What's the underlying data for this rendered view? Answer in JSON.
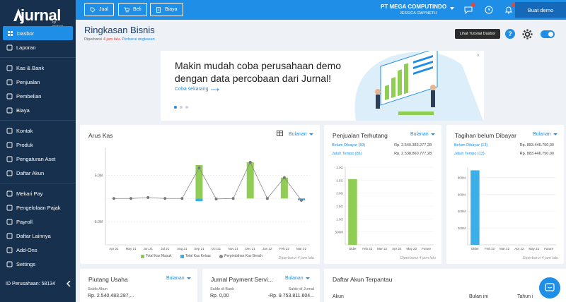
{
  "sidebar": {
    "logo": "jurnal",
    "logo_sub": "by mekari",
    "items": [
      {
        "label": "Dasbor",
        "icon": "dashboard-icon"
      },
      {
        "label": "Laporan",
        "icon": "report-icon"
      },
      {
        "label": "Kas & Bank",
        "icon": "bank-icon"
      },
      {
        "label": "Penjualan",
        "icon": "tag-icon"
      },
      {
        "label": "Pembelian",
        "icon": "cart-icon"
      },
      {
        "label": "Biaya",
        "icon": "receipt-icon"
      },
      {
        "label": "Kontak",
        "icon": "contact-icon"
      },
      {
        "label": "Produk",
        "icon": "box-icon"
      },
      {
        "label": "Pengaturan Aset",
        "icon": "asset-icon"
      },
      {
        "label": "Daftar Akun",
        "icon": "list-icon"
      },
      {
        "label": "Mekari Pay",
        "icon": "pay-icon"
      },
      {
        "label": "Pengelolaan Pajak",
        "icon": "tax-icon"
      },
      {
        "label": "Payroll",
        "icon": "payroll-icon"
      },
      {
        "label": "Daftar Lainnya",
        "icon": "clipboard-icon"
      },
      {
        "label": "Add-Ons",
        "icon": "addon-icon"
      },
      {
        "label": "Settings",
        "icon": "settings-icon"
      }
    ],
    "company_id": "ID Perusahaan: 58134"
  },
  "header": {
    "buttons": [
      "Jual",
      "Beli",
      "Biaya"
    ],
    "company": "PT MEGA COMPUTINDO",
    "user": "JESSICA GWYNETH",
    "demo": "Buat demo"
  },
  "page": {
    "title": "Ringkasan Bisnis",
    "updated_prefix": "Diperbarui",
    "updated_time": "4 jam lalu.",
    "refresh": "Perbarui ringkasan",
    "tooltip": "Lihat Tutorial Dasbor",
    "help": "?"
  },
  "banner": {
    "title": "Makin mudah coba perusahaan demo dengan data percobaan dari Jurnal!",
    "link": "Coba sekarang",
    "close": "×"
  },
  "arus_kas": {
    "title": "Arus Kas",
    "dropdown": "Bulanan",
    "footer": "Diperbarui 4 jam lalu",
    "legend": [
      "Total Kas Masuk",
      "Total Kas Keluar",
      "Perpindahan Kas Bersih"
    ]
  },
  "penjualan": {
    "title": "Penjualan Terhutang",
    "dropdown": "Bulanan",
    "rows": [
      {
        "label": "Belum Dibayar (83)",
        "value": "Rp. 2.540.383.277,28"
      },
      {
        "label": "Jatuh Tempo (81)",
        "value": "Rp. 2.538.860.777,28"
      }
    ],
    "footer": "Diperbarui 4 jam lalu"
  },
  "tagihan": {
    "title": "Tagihan belum Dibayar",
    "dropdown": "Bulanan",
    "rows": [
      {
        "label": "Belum Dibayar (13)",
        "value": "Rp. 883.446.750,00"
      },
      {
        "label": "Jatuh Tempo (13)",
        "value": "Rp. 883.446.750,00"
      }
    ],
    "footer": "Diperbarui 4 jam lalu"
  },
  "piutang": {
    "title": "Piutang Usaha",
    "dropdown": "Bulanan",
    "label": "Saldo Akun",
    "value": "Rp. 2.540.483.287,..."
  },
  "jurnal_pay": {
    "title": "Jurnal Payment Servi...",
    "dropdown": "Bulanan",
    "label1": "Saldo di Bank",
    "value1": "Rp. 0,00",
    "label2": "Saldo di Jurnal",
    "value2": "-Rp. 9.753.811.604..."
  },
  "daftar_akun": {
    "title": "Daftar Akun Terpantau",
    "col1": "Akun",
    "col2": "Bulan ini",
    "col3": "Tahun i"
  },
  "colors": {
    "primary": "#1e8ee6",
    "sidebar": "#17304d",
    "green": "#8fcd55",
    "blue": "#3dafe8"
  },
  "chart_data": [
    {
      "type": "bar",
      "title": "Arus Kas",
      "categories": [
        "Apr 21",
        "May 21",
        "Jun 21",
        "Jul 21",
        "Aug 21",
        "Sep 21",
        "Oct 21",
        "Nov 21",
        "Dec 21",
        "Jan 22",
        "Feb 22",
        "Mar 22"
      ],
      "series": [
        {
          "name": "Total Kas Masuk",
          "values": [
            0,
            0,
            0,
            0,
            0,
            7.2,
            0,
            0,
            7.8,
            0,
            4.5,
            0
          ]
        },
        {
          "name": "Total Kas Keluar",
          "values": [
            0,
            0,
            0,
            0,
            0,
            -0.6,
            0,
            0,
            0,
            0,
            0,
            -0.4
          ]
        },
        {
          "name": "Perpindahan Kas Bersih",
          "values": [
            0,
            0,
            0.2,
            0,
            0,
            6.6,
            -0.1,
            0,
            7.8,
            0,
            4.5,
            -0.4
          ]
        }
      ],
      "y_ticks": [
        "5.0M",
        "-5.0M"
      ],
      "ylim": [
        -10,
        11
      ]
    },
    {
      "type": "bar",
      "title": "Penjualan Terhutang",
      "categories": [
        "Older",
        "Feb 22",
        "Mar 22",
        "Apr 22",
        "May 22",
        "Future"
      ],
      "values": [
        2.54,
        0,
        0,
        0,
        0,
        0
      ],
      "y_ticks": [
        "3.0G",
        "2.5G",
        "2.0G",
        "1.5G",
        "1.0G",
        "500M"
      ],
      "ylim": [
        0,
        3.0
      ]
    },
    {
      "type": "bar",
      "title": "Tagihan belum Dibayar",
      "categories": [
        "Older",
        "Feb 22",
        "Mar 22",
        "Apr 22",
        "May 22",
        "Future"
      ],
      "values": [
        883,
        0,
        0,
        0,
        0,
        0
      ],
      "y_ticks": [
        "800M",
        "600M",
        "400M",
        "200M"
      ],
      "ylim": [
        0,
        920
      ]
    }
  ]
}
